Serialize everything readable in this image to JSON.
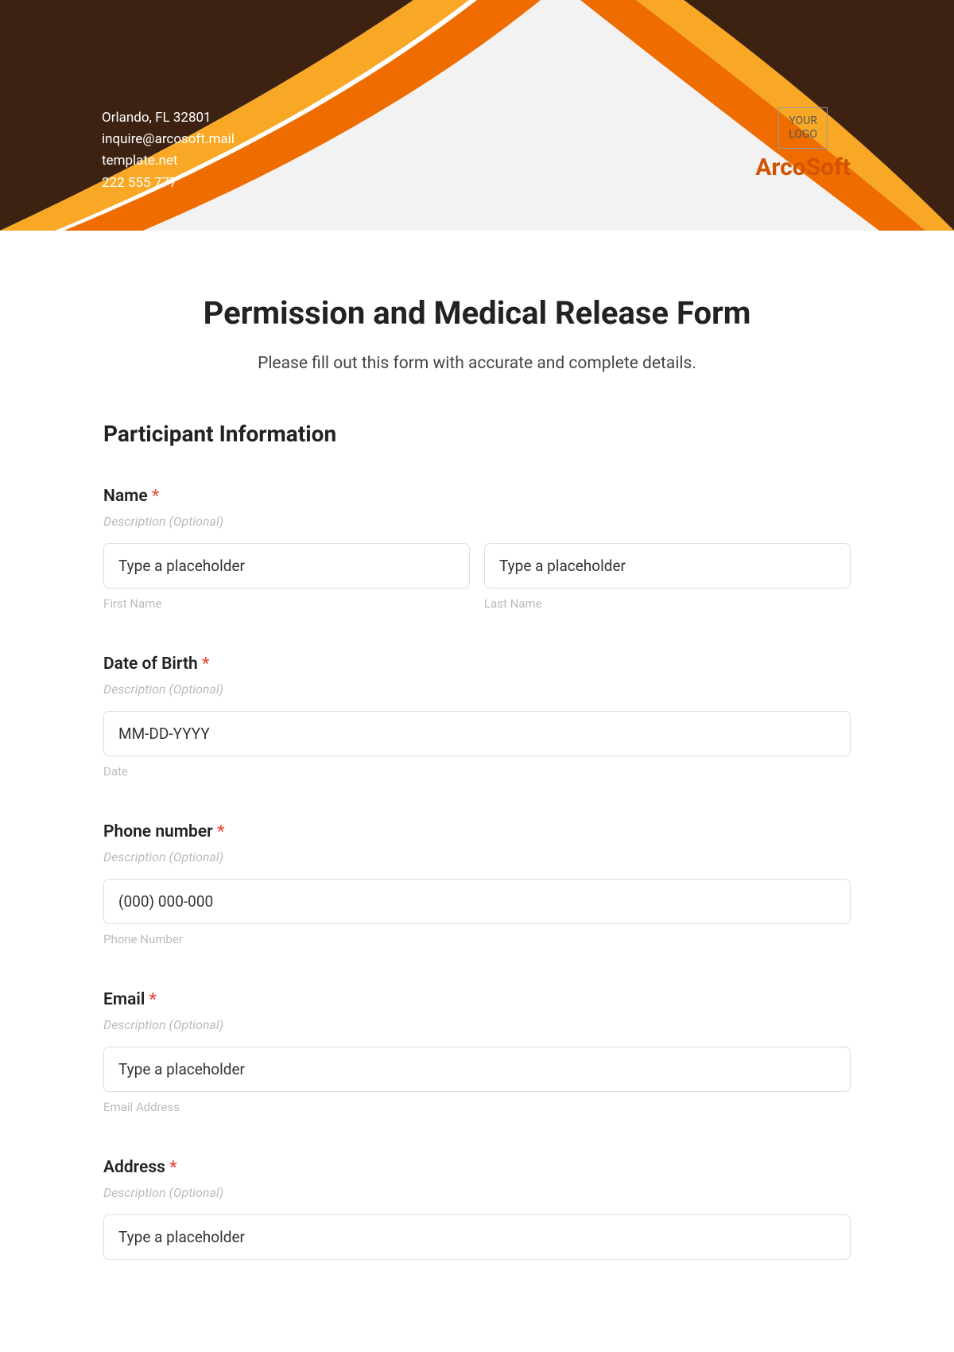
{
  "header": {
    "address": "Orlando, FL 32801",
    "email": "inquire@arcosoft.mail",
    "website": "template.net",
    "phone": "222 555 777",
    "logo_text_line1": "YOUR",
    "logo_text_line2": "LOGO",
    "company_name": "ArcoSoft"
  },
  "form": {
    "title": "Permission and Medical Release Form",
    "subtitle": "Please fill out this form with accurate and complete details.",
    "section_title": "Participant Information",
    "description_optional": "Description (Optional)",
    "required_star": "*",
    "fields": {
      "name": {
        "label": "Name",
        "first_placeholder": "Type a placeholder",
        "last_placeholder": "Type a placeholder",
        "first_sublabel": "First Name",
        "last_sublabel": "Last Name"
      },
      "dob": {
        "label": "Date of Birth",
        "placeholder": "MM-DD-YYYY",
        "sublabel": "Date"
      },
      "phone": {
        "label": "Phone number",
        "placeholder": "(000) 000-000",
        "sublabel": "Phone Number"
      },
      "email": {
        "label": "Email",
        "placeholder": "Type a placeholder",
        "sublabel": "Email Address"
      },
      "address": {
        "label": "Address",
        "placeholder": "Type a placeholder"
      }
    }
  }
}
